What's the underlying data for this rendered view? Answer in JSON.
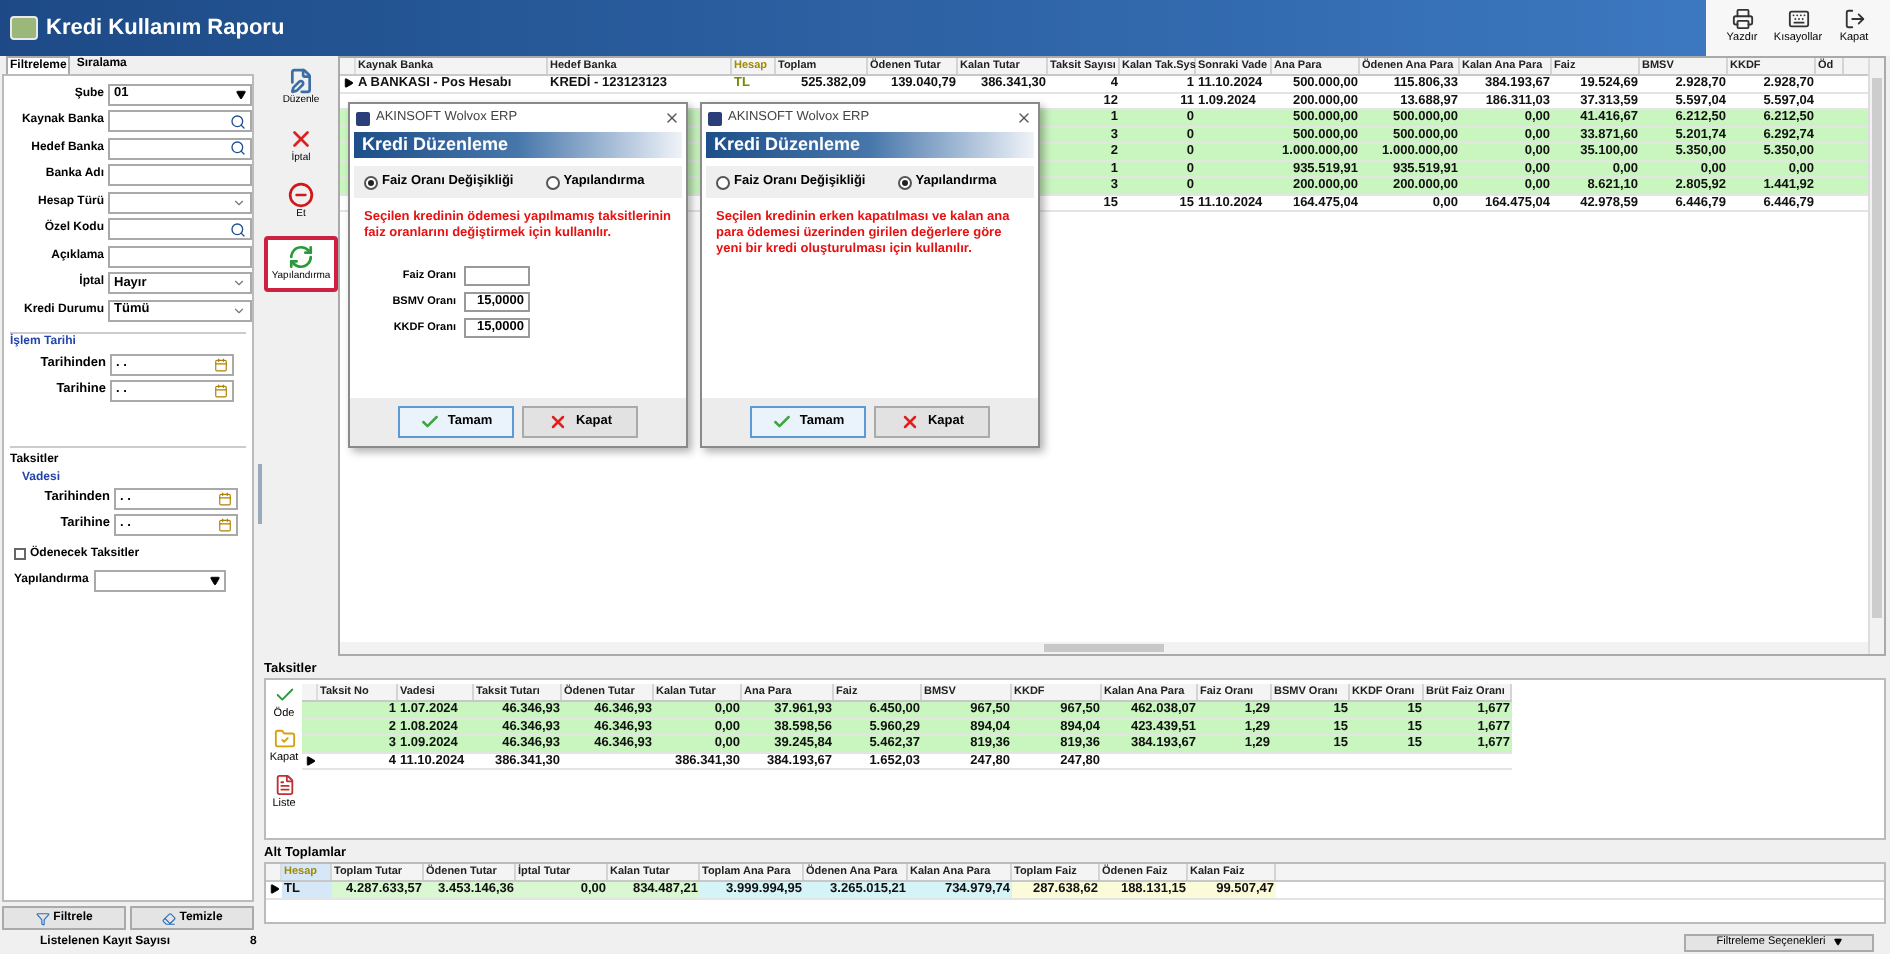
{
  "window": {
    "title": "Kredi Kullanım Raporu"
  },
  "top_toolbar": [
    {
      "label": "Yazdır",
      "kind": "print"
    },
    {
      "label": "Kısayollar",
      "kind": "shortcuts"
    },
    {
      "label": "Kapat",
      "kind": "close"
    }
  ],
  "filter_panel": {
    "tabs": [
      {
        "label": "Filtreleme",
        "selected": true
      },
      {
        "label": "Sıralama",
        "selected": false
      }
    ],
    "fields": [
      {
        "label": "Şube",
        "kind": "select",
        "value": "01"
      },
      {
        "label": "Kaynak Banka",
        "kind": "lookup"
      },
      {
        "label": "Hedef Banka",
        "kind": "lookup"
      },
      {
        "label": "Banka Adı",
        "kind": "text"
      },
      {
        "label": "Hesap Türü",
        "kind": "combo"
      },
      {
        "label": "Özel Kodu",
        "kind": "lookup"
      },
      {
        "label": "Açıklama",
        "kind": "text"
      },
      {
        "label": "İptal",
        "kind": "combo",
        "value": "Hayır"
      },
      {
        "label": "Kredi Durumu",
        "kind": "combo",
        "value": "Tümü"
      }
    ],
    "process_date": {
      "title": "İşlem Tarihi",
      "fields": [
        {
          "label": "Tarihinden",
          "value": ". ."
        },
        {
          "label": "Tarihine",
          "value": ". ."
        }
      ]
    },
    "installments": {
      "title": "Taksitler",
      "subtitle": "Vadesi",
      "fields": [
        {
          "label": "Tarihinden",
          "value": ". ."
        },
        {
          "label": "Tarihine",
          "value": ". ."
        }
      ]
    },
    "payable": {
      "label": "Ödenecek Taksitler",
      "checked": false
    },
    "restructure": {
      "label": "Yapılandırma"
    },
    "buttons": [
      {
        "label": "Filtrele",
        "kind": "filter"
      },
      {
        "label": "Temizle",
        "kind": "clear"
      }
    ]
  },
  "side_toolbar": [
    {
      "label": "Düzenle",
      "kind": "edit",
      "selected": false
    },
    {
      "label": "İptal",
      "kind": "cancel",
      "selected": false
    },
    {
      "label": "Et",
      "kind": "stop",
      "selected": false
    },
    {
      "label": "Yapılandırma",
      "kind": "restructure",
      "selected": true
    }
  ],
  "main_table": {
    "columns": [
      "Kaynak Banka",
      "Hedef Banka",
      "Hesap",
      "Toplam",
      "Ödenen Tutar",
      "Kalan Tutar",
      "Taksit Sayısı",
      "Kalan Tak.Sys",
      "Sonraki Vade",
      "Ana Para",
      "Ödenen Ana Para",
      "Kalan Ana Para",
      "Faiz",
      "BMSV",
      "KKDF",
      "Öd"
    ],
    "rows": [
      {
        "selected": true,
        "paid": false,
        "cells": [
          "A BANKASI - Pos Hesabı",
          "KREDİ - 123123123",
          "TL",
          "525.382,09",
          "139.040,79",
          "386.341,30",
          "4",
          "1",
          "11.10.2024",
          "500.000,00",
          "115.806,33",
          "384.193,67",
          "19.524,69",
          "2.928,70",
          "2.928,70"
        ]
      },
      {
        "selected": false,
        "paid": false,
        "cells": [
          null,
          null,
          null,
          null,
          null,
          null,
          "12",
          "11",
          "1.09.2024",
          "200.000,00",
          "13.688,97",
          "186.311,03",
          "37.313,59",
          "5.597,04",
          "5.597,04"
        ]
      },
      {
        "selected": false,
        "paid": true,
        "cells": [
          null,
          null,
          null,
          null,
          null,
          null,
          "1",
          "0",
          null,
          "500.000,00",
          "500.000,00",
          "0,00",
          "41.416,67",
          "6.212,50",
          "6.212,50"
        ]
      },
      {
        "selected": false,
        "paid": true,
        "cells": [
          null,
          null,
          null,
          null,
          null,
          null,
          "3",
          "0",
          null,
          "500.000,00",
          "500.000,00",
          "0,00",
          "33.871,60",
          "5.201,74",
          "6.292,74"
        ]
      },
      {
        "selected": false,
        "paid": true,
        "cells": [
          null,
          null,
          null,
          null,
          null,
          null,
          "2",
          "0",
          null,
          "1.000.000,00",
          "1.000.000,00",
          "0,00",
          "35.100,00",
          "5.350,00",
          "5.350,00"
        ]
      },
      {
        "selected": false,
        "paid": true,
        "cells": [
          null,
          null,
          null,
          null,
          null,
          null,
          "1",
          "0",
          null,
          "935.519,91",
          "935.519,91",
          "0,00",
          "0,00",
          "0,00",
          "0,00"
        ]
      },
      {
        "selected": false,
        "paid": true,
        "cells": [
          null,
          null,
          null,
          null,
          null,
          null,
          "3",
          "0",
          null,
          "200.000,00",
          "200.000,00",
          "0,00",
          "8.621,10",
          "2.805,92",
          "1.441,92"
        ]
      },
      {
        "selected": false,
        "paid": false,
        "cells": [
          null,
          null,
          null,
          null,
          null,
          null,
          "15",
          "15",
          "11.10.2024",
          "164.475,04",
          "0,00",
          "164.475,04",
          "42.978,59",
          "6.446,79",
          "6.446,79"
        ]
      }
    ]
  },
  "dialogs": [
    {
      "app": "AKINSOFT Wolvox ERP",
      "title": "Kredi Düzenleme",
      "options": [
        {
          "label": "Faiz Oranı Değişikliği",
          "selected": true
        },
        {
          "label": "Yapılandırma",
          "selected": false
        }
      ],
      "description": "Seçilen kredinin ödemesi yapılmamış taksitlerinin faiz oranlarını değiştirmek için kullanılır.",
      "fields": [
        {
          "label": "Faiz Oranı"
        },
        {
          "label": "BSMV Oranı",
          "value": "15,0000"
        },
        {
          "label": "KKDF Oranı",
          "value": "15,0000"
        }
      ],
      "buttons": [
        {
          "label": "Tamam",
          "kind": "ok"
        },
        {
          "label": "Kapat",
          "kind": "close"
        }
      ]
    },
    {
      "app": "AKINSOFT Wolvox ERP",
      "title": "Kredi Düzenleme",
      "options": [
        {
          "label": "Faiz Oranı Değişikliği",
          "selected": false
        },
        {
          "label": "Yapılandırma",
          "selected": true
        }
      ],
      "description": "Seçilen kredinin erken kapatılması ve kalan ana para ödemesi üzerinden girilen değerlere göre yeni bir kredi oluşturulması için kullanılır.",
      "buttons": [
        {
          "label": "Tamam",
          "kind": "ok"
        },
        {
          "label": "Kapat",
          "kind": "close"
        }
      ]
    }
  ],
  "installments": {
    "title": "Taksitler",
    "actions": [
      {
        "label": "Öde",
        "kind": "pay"
      },
      {
        "label": "Kapat",
        "kind": "close"
      },
      {
        "label": "Liste",
        "kind": "list"
      }
    ],
    "columns": [
      "Taksit No",
      "Vadesi",
      "Taksit Tutarı",
      "Ödenen Tutar",
      "Kalan Tutar",
      "Ana Para",
      "Faiz",
      "BMSV",
      "KKDF",
      "Kalan Ana Para",
      "Faiz Oranı",
      "BSMV Oranı",
      "KKDF Oranı",
      "Brüt Faiz Oranı"
    ],
    "rows": [
      {
        "selected": false,
        "paid": true,
        "cells": [
          "1",
          "1.07.2024",
          "46.346,93",
          "46.346,93",
          "0,00",
          "37.961,93",
          "6.450,00",
          "967,50",
          "967,50",
          "462.038,07",
          "1,29",
          "15",
          "15",
          "1,677"
        ]
      },
      {
        "selected": false,
        "paid": true,
        "cells": [
          "2",
          "1.08.2024",
          "46.346,93",
          "46.346,93",
          "0,00",
          "38.598,56",
          "5.960,29",
          "894,04",
          "894,04",
          "423.439,51",
          "1,29",
          "15",
          "15",
          "1,677"
        ]
      },
      {
        "selected": false,
        "paid": true,
        "cells": [
          "3",
          "1.09.2024",
          "46.346,93",
          "46.346,93",
          "0,00",
          "39.245,84",
          "5.462,37",
          "819,36",
          "819,36",
          "384.193,67",
          "1,29",
          "15",
          "15",
          "1,677"
        ]
      },
      {
        "selected": true,
        "paid": false,
        "cells": [
          "4",
          "11.10.2024",
          "386.341,30",
          null,
          "386.341,30",
          "384.193,67",
          "1.652,03",
          "247,80",
          "247,80",
          null,
          null,
          null,
          null,
          null
        ]
      }
    ]
  },
  "subtotals": {
    "title": "Alt Toplamlar",
    "columns": [
      {
        "label": "Hesap",
        "color": "#d6e8f7"
      },
      {
        "label": "Toplam Tutar",
        "color": "#d9f7d0"
      },
      {
        "label": "Ödenen Tutar",
        "color": "#d9f7d0"
      },
      {
        "label": "İptal Tutar",
        "color": "#d9f7d0"
      },
      {
        "label": "Kalan Tutar",
        "color": "#d9f7d0"
      },
      {
        "label": "Toplam Ana Para",
        "color": "#d4f4f7"
      },
      {
        "label": "Ödenen Ana Para",
        "color": "#d4f4f7"
      },
      {
        "label": "Kalan Ana Para",
        "color": "#d4f4f7"
      },
      {
        "label": "Toplam Faiz",
        "color": "#fcfbd9"
      },
      {
        "label": "Ödenen Faiz",
        "color": "#fcfbd9"
      },
      {
        "label": "Kalan Faiz",
        "color": "#fcfbd9"
      }
    ],
    "rows": [
      {
        "selected": true,
        "cells": [
          "TL",
          "4.287.633,57",
          "3.453.146,36",
          "0,00",
          "834.487,21",
          "3.999.994,95",
          "3.265.015,21",
          "734.979,74",
          "287.638,62",
          "188.131,15",
          "99.507,47"
        ]
      }
    ]
  },
  "status_bar": {
    "label": "Listelenen Kayıt Sayısı",
    "count": "8",
    "filter_options": "Filtreleme Seçenekleri"
  }
}
